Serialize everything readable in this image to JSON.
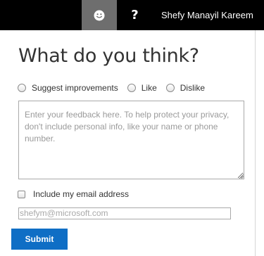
{
  "topbar": {
    "feedback_icon": "smiley-icon",
    "help_label": "?",
    "help_icon": "help-icon",
    "user_name": "Shefy Manayil Kareem",
    "colors": {
      "background": "#000000",
      "active_button": "#6e6e6e"
    }
  },
  "form": {
    "title": "What do you think?",
    "options": [
      {
        "label": "Suggest improvements",
        "selected": false
      },
      {
        "label": "Like",
        "selected": false
      },
      {
        "label": "Dislike",
        "selected": false
      }
    ],
    "feedback_placeholder": "Enter your feedback here. To help protect your privacy, don't include personal info, like your name or phone number.",
    "include_email_label": "Include my email address",
    "include_email_checked": false,
    "email_value": "shefym@microsoft.com",
    "submit_label": "Submit",
    "submit_color": "#0f6ec5"
  }
}
